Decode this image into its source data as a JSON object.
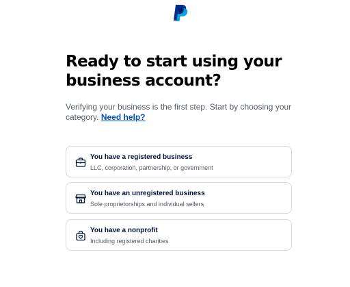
{
  "brand": {
    "logo_icon": "paypal-logo-icon",
    "colors": {
      "dark_blue": "#002c8a",
      "light_blue": "#009be1",
      "link": "#0551b5"
    }
  },
  "heading": "Ready to start using your business account?",
  "subtitle": {
    "text": "Verifying your business is the first step. Start by choosing your category.",
    "help_link": "Need help?"
  },
  "options": [
    {
      "title": "You have a registered business",
      "description": "LLC, corporation, partnership, or government",
      "icon": "briefcase-icon"
    },
    {
      "title": "You have an unregistered business",
      "description": "Sole proprietorships and individual sellers",
      "icon": "storefront-icon"
    },
    {
      "title": "You have a nonprofit",
      "description": "Including registered charities",
      "icon": "charity-bag-heart-icon"
    }
  ]
}
